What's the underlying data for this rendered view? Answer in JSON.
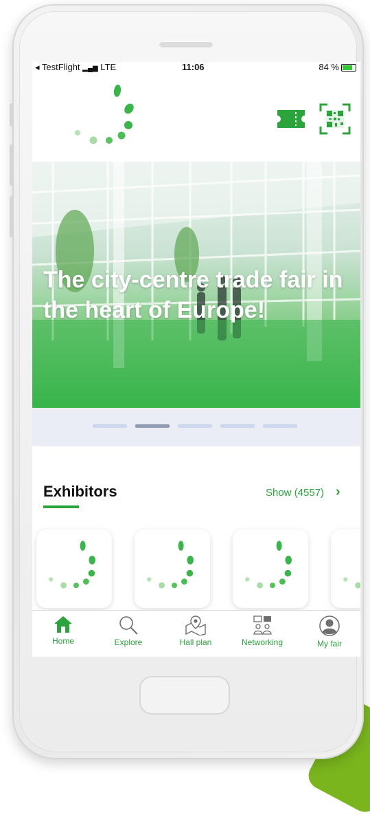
{
  "status_bar": {
    "carrier": "◂ TestFlight",
    "network": "LTE",
    "time": "11:06",
    "battery": "84 %"
  },
  "header": {
    "logo_icon": "spinner-dots-logo",
    "ticket_icon": "ticket-icon",
    "qr_icon": "qr-code-scan-icon",
    "accent_color": "#2aa43b"
  },
  "hero": {
    "title": "The city-centre trade fair in the heart of Europe!",
    "carousel_pages": 5,
    "active_page": 2
  },
  "exhibitors": {
    "title": "Exhibitors",
    "show_label": "Show (4557)",
    "chevron_icon": "chevron-right-icon",
    "cards": [
      "exhibitor-logo-1",
      "exhibitor-logo-2",
      "exhibitor-logo-3",
      "exhibitor-logo-4"
    ]
  },
  "tabbar": {
    "items": [
      {
        "label": "Home",
        "icon": "home-icon",
        "active": true
      },
      {
        "label": "Explore",
        "icon": "search-icon",
        "active": false
      },
      {
        "label": "Hall plan",
        "icon": "map-pin-icon",
        "active": false
      },
      {
        "label": "Networking",
        "icon": "networking-icon",
        "active": false
      },
      {
        "label": "My fair",
        "icon": "user-circle-icon",
        "active": false
      }
    ]
  }
}
